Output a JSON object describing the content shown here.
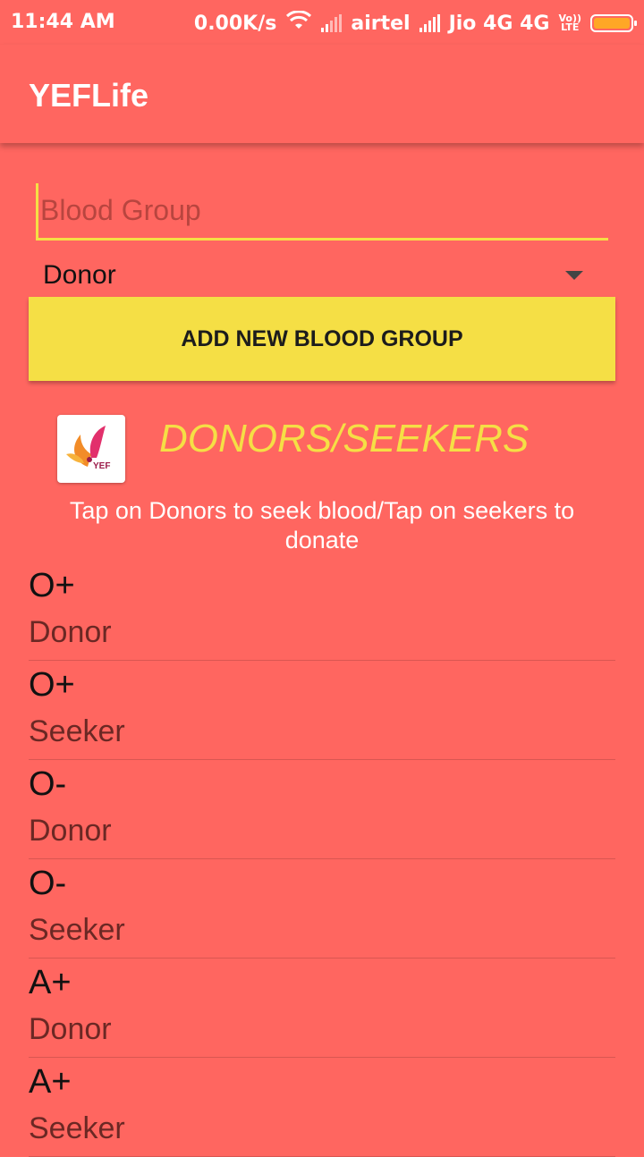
{
  "status_bar": {
    "time": "11:44 AM",
    "net_speed": "0.00K/s",
    "carrier1": "airtel",
    "carrier2": "Jio 4G 4G",
    "volte_top": "Vo))",
    "volte_bottom": "LTE",
    "icons": [
      "wifi-icon",
      "signal-icon",
      "signal-icon",
      "volte-icon",
      "battery-icon"
    ]
  },
  "app_bar": {
    "title": "YEFLife"
  },
  "form": {
    "blood_group_placeholder": "Blood Group",
    "blood_group_value": "",
    "type_selected": "Donor",
    "add_button_label": "ADD NEW BLOOD GROUP"
  },
  "section": {
    "title": "DONORS/SEEKERS",
    "hint": "Tap on Donors to seek blood/Tap on seekers to donate",
    "logo_text": "YEF"
  },
  "list": [
    {
      "group": "O+",
      "type": "Donor"
    },
    {
      "group": "O+",
      "type": "Seeker"
    },
    {
      "group": "O-",
      "type": "Donor"
    },
    {
      "group": "O-",
      "type": "Seeker"
    },
    {
      "group": "A+",
      "type": "Donor"
    },
    {
      "group": "A+",
      "type": "Seeker"
    }
  ],
  "colors": {
    "background": "#FF6660",
    "accent_yellow": "#F5DF45",
    "battery": "#FFA726"
  }
}
